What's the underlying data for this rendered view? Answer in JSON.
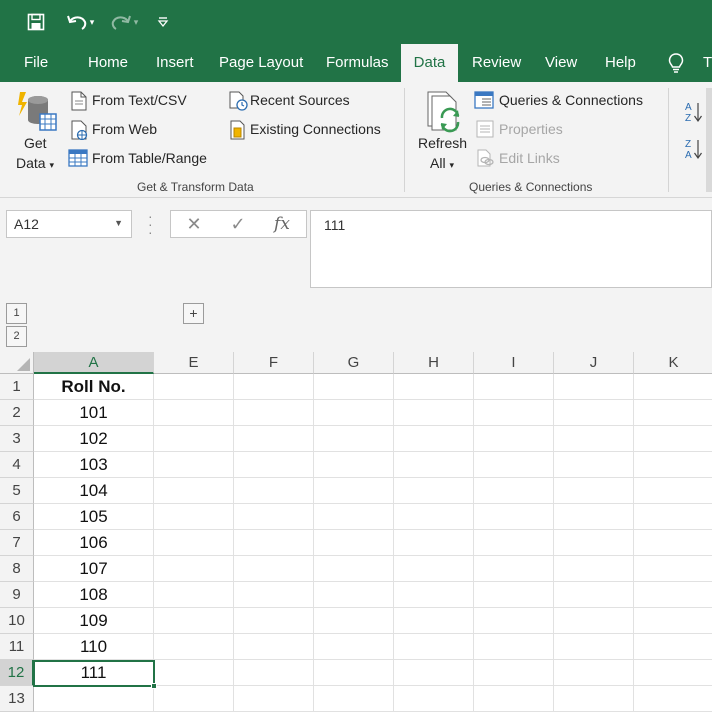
{
  "colors": {
    "accent": "#217346",
    "ribbon_bg": "#f3f3f3"
  },
  "qat": {
    "icons": [
      "save-icon",
      "undo-icon",
      "redo-icon",
      "customize-icon"
    ]
  },
  "tabs": [
    {
      "label": "File"
    },
    {
      "label": "Home"
    },
    {
      "label": "Insert"
    },
    {
      "label": "Page Layout"
    },
    {
      "label": "Formulas"
    },
    {
      "label": "Data",
      "active": true
    },
    {
      "label": "Review"
    },
    {
      "label": "View"
    },
    {
      "label": "Help"
    },
    {
      "label": "T"
    }
  ],
  "ribbon": {
    "get_data": {
      "line1": "Get",
      "line2": "Data"
    },
    "from_text_csv": "From Text/CSV",
    "from_web": "From Web",
    "from_table_range": "From Table/Range",
    "recent_sources": "Recent Sources",
    "existing_connections": "Existing Connections",
    "group_get_transform": "Get & Transform Data",
    "refresh_all": {
      "line1": "Refresh",
      "line2": "All"
    },
    "queries_connections": "Queries & Connections",
    "properties": "Properties",
    "edit_links": "Edit Links",
    "group_queries": "Queries & Connections"
  },
  "formula_bar": {
    "name_box": "A12",
    "cancel": "✕",
    "enter": "✓",
    "fx": "fx",
    "value": "111"
  },
  "outline": {
    "level1": "1",
    "level2": "2",
    "expand": "+"
  },
  "grid": {
    "columns": [
      "A",
      "E",
      "F",
      "G",
      "H",
      "I",
      "J",
      "K"
    ],
    "rows": [
      "1",
      "2",
      "3",
      "4",
      "5",
      "6",
      "7",
      "8",
      "9",
      "10",
      "11",
      "12",
      "13"
    ],
    "col_a_values": [
      "Roll No.",
      "101",
      "102",
      "103",
      "104",
      "105",
      "106",
      "107",
      "108",
      "109",
      "110",
      "111",
      ""
    ],
    "selected_cell": "A12"
  }
}
